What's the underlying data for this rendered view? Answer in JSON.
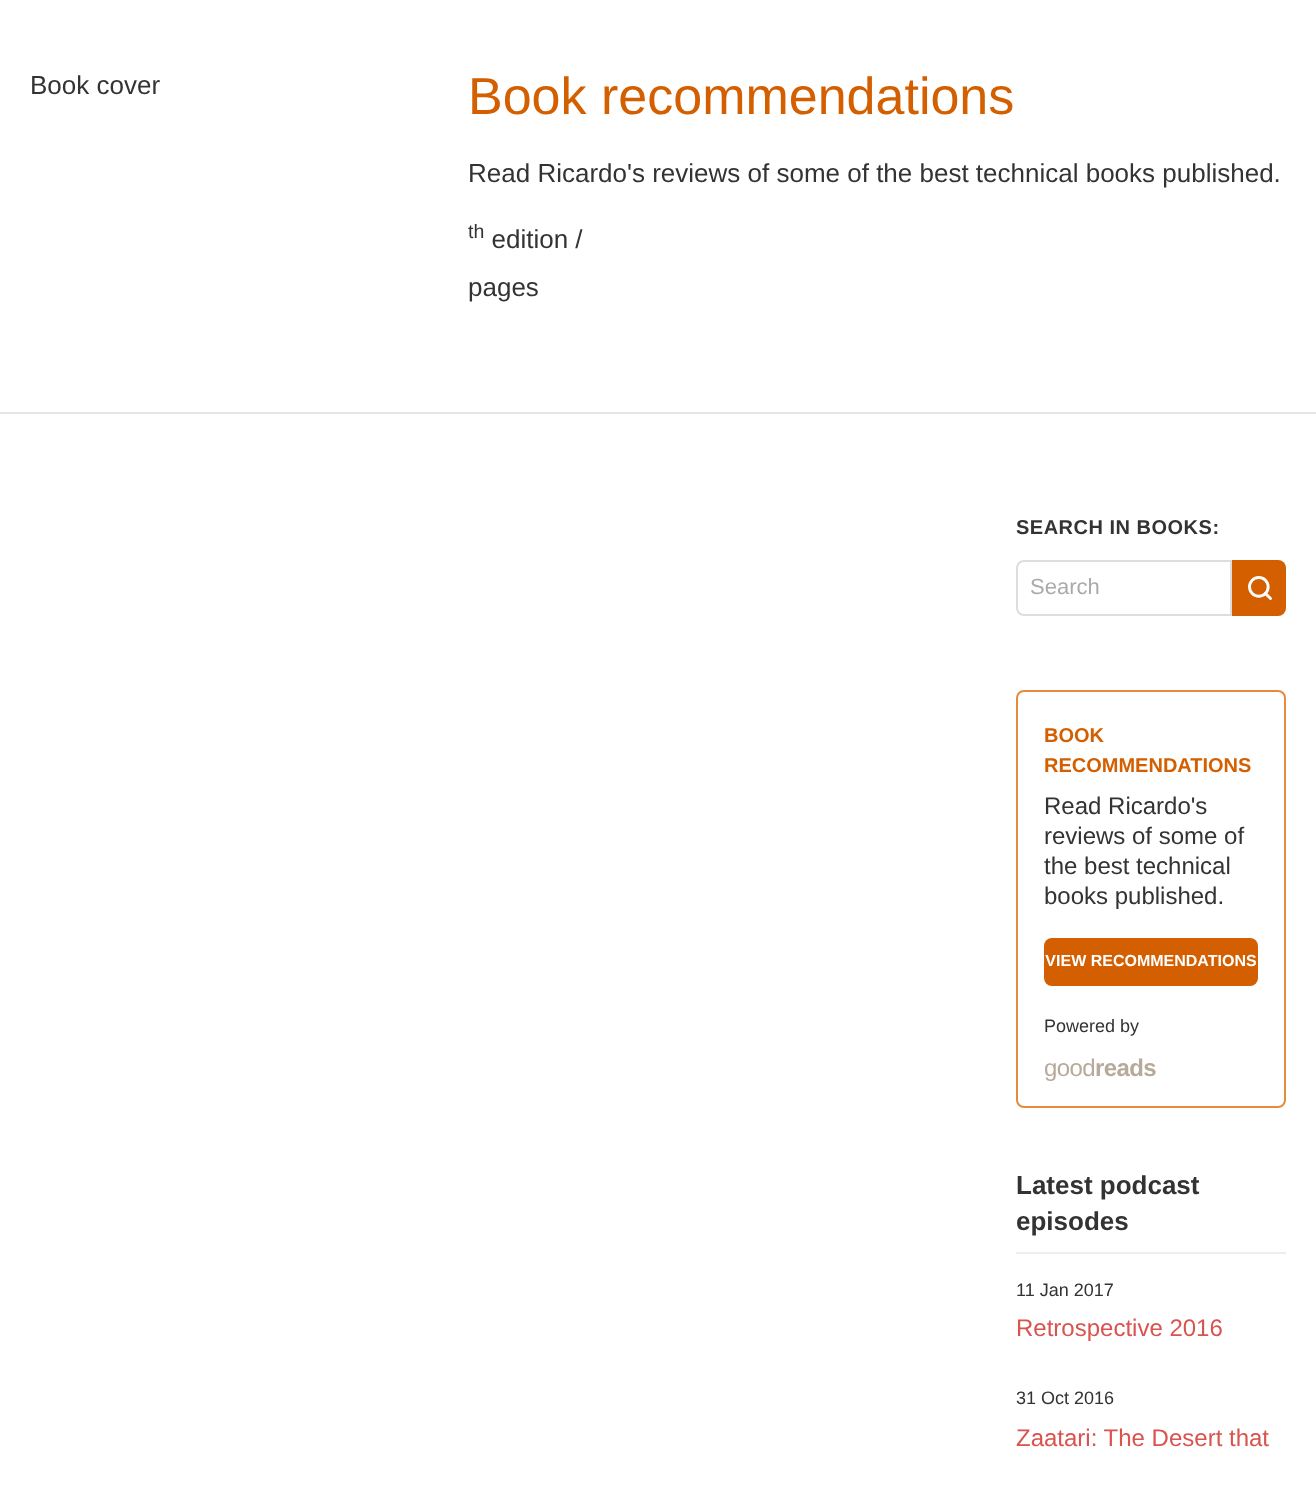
{
  "header": {
    "cover_alt": "Book cover",
    "title": "Book recommendations",
    "description": "Read Ricardo's reviews of some of the best technical books published.",
    "edition": "$^{th}$ edition /",
    "pages": "pages"
  },
  "sidebar": {
    "search": {
      "heading": "SEARCH IN BOOKS:",
      "placeholder": "Search"
    },
    "widget": {
      "heading": "BOOK RECOMMENDATIONS",
      "text": "Read Ricardo's reviews of some of the best technical books published.",
      "button": "VIEW RECOMMENDATIONS",
      "powered_by": "Powered by",
      "logo": "good**reads**"
    },
    "podcast": {
      "heading": "Latest podcast episodes",
      "episodes": [
        {
          "date": "11 Jan 2017",
          "title": "Retrospective 2016"
        },
        {
          "date": "31 Oct 2016",
          "title": "Zaatari: The Desert that"
        }
      ]
    }
  }
}
